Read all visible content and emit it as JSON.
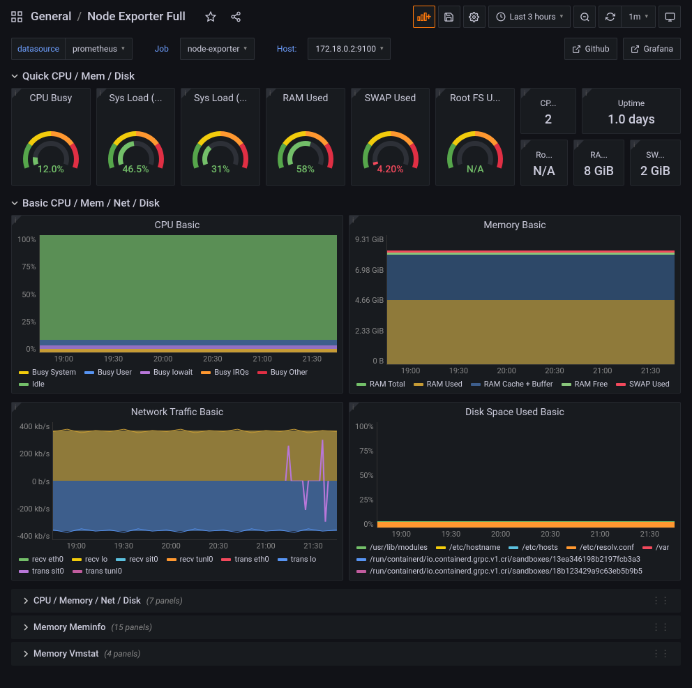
{
  "breadcrumb": {
    "parent": "General",
    "title": "Node Exporter Full"
  },
  "toolbar": {
    "time_range": "Last 3 hours",
    "refresh": "1m"
  },
  "vars": {
    "ds_label": "datasource",
    "ds_value": "prometheus",
    "job_label": "Job",
    "job_value": "node-exporter",
    "host_label": "Host:",
    "host_value": "172.18.0.2:9100"
  },
  "links": {
    "github": "Github",
    "grafana": "Grafana"
  },
  "sections": {
    "quick": "Quick CPU / Mem / Disk",
    "basic": "Basic CPU / Mem / Net / Disk",
    "r1": "CPU / Memory / Net / Disk",
    "r1c": "(7 panels)",
    "r2": "Memory Meminfo",
    "r2c": "(15 panels)",
    "r3": "Memory Vmstat",
    "r3c": "(4 panels)"
  },
  "gauges": [
    {
      "title": "CPU Busy",
      "value": "12.0%",
      "pct": 12,
      "color": "#73bf69"
    },
    {
      "title": "Sys Load (...",
      "value": "46.5%",
      "pct": 46.5,
      "color": "#73bf69"
    },
    {
      "title": "Sys Load (...",
      "value": "31%",
      "pct": 31,
      "color": "#73bf69"
    },
    {
      "title": "RAM Used",
      "value": "58%",
      "pct": 58,
      "color": "#73bf69"
    },
    {
      "title": "SWAP Used",
      "value": "4.20%",
      "pct": 4.2,
      "color": "#f2495c"
    },
    {
      "title": "Root FS U...",
      "value": "N/A",
      "pct": 0,
      "color": "#73bf69"
    }
  ],
  "stats": [
    {
      "title": "CP...",
      "value": "2"
    },
    {
      "title": "Uptime",
      "value": "1.0 days",
      "wide": true
    },
    {
      "title": "Ro...",
      "value": "N/A"
    },
    {
      "title": "RA...",
      "value": "8 GiB"
    },
    {
      "title": "SW...",
      "value": "2 GiB"
    }
  ],
  "x_ticks": [
    "19:00",
    "19:30",
    "20:00",
    "20:30",
    "21:00",
    "21:30"
  ],
  "chart_data": [
    {
      "type": "area",
      "title": "CPU Basic",
      "y_ticks": [
        "100%",
        "75%",
        "50%",
        "25%",
        "0%"
      ],
      "x_ticks": [
        "19:00",
        "19:30",
        "20:00",
        "20:30",
        "21:00",
        "21:30"
      ],
      "series": [
        {
          "name": "Busy System",
          "color": "#f2cc0c",
          "approx_pct": 3
        },
        {
          "name": "Busy User",
          "color": "#5794f2",
          "approx_pct": 5
        },
        {
          "name": "Busy Iowait",
          "color": "#b877d9",
          "approx_pct": 1
        },
        {
          "name": "Busy IRQs",
          "color": "#ff9830",
          "approx_pct": 1
        },
        {
          "name": "Busy Other",
          "color": "#e02f44",
          "approx_pct": 1
        },
        {
          "name": "Idle",
          "color": "#73bf69",
          "approx_pct": 89
        }
      ]
    },
    {
      "type": "area",
      "title": "Memory Basic",
      "y_ticks": [
        "9.31 GiB",
        "6.98 GiB",
        "4.66 GiB",
        "2.33 GiB",
        "0 B"
      ],
      "x_ticks": [
        "19:00",
        "19:30",
        "20:00",
        "20:30",
        "21:00",
        "21:30"
      ],
      "series": [
        {
          "name": "RAM Total",
          "color": "#73bf69",
          "approx_gib": 8.0
        },
        {
          "name": "RAM Used",
          "color": "#c69b35",
          "approx_gib": 4.6
        },
        {
          "name": "RAM Cache + Buffer",
          "color": "#3d5e8c",
          "approx_gib": 3.3
        },
        {
          "name": "RAM Free",
          "color": "#89c67b",
          "approx_gib": 0.1
        },
        {
          "name": "SWAP Used",
          "color": "#f2495c",
          "approx_gib": 0.08
        }
      ]
    },
    {
      "type": "area",
      "title": "Network Traffic Basic",
      "y_ticks": [
        "400 kb/s",
        "200 kb/s",
        "0 b/s",
        "-200 kb/s",
        "-400 kb/s"
      ],
      "x_ticks": [
        "19:00",
        "19:30",
        "20:00",
        "20:30",
        "21:00",
        "21:30"
      ],
      "series": [
        {
          "name": "recv eth0",
          "color": "#73bf69",
          "approx_kbps": 350
        },
        {
          "name": "recv lo",
          "color": "#f2cc0c",
          "approx_kbps": 340
        },
        {
          "name": "recv sit0",
          "color": "#5bc0de",
          "approx_kbps": 0
        },
        {
          "name": "recv tunl0",
          "color": "#ff9830",
          "approx_kbps": 0
        },
        {
          "name": "trans eth0",
          "color": "#f2495c",
          "approx_kbps": -350
        },
        {
          "name": "trans lo",
          "color": "#5794f2",
          "approx_kbps": -340
        },
        {
          "name": "trans sit0",
          "color": "#b877d9",
          "approx_kbps": 0
        },
        {
          "name": "trans tunl0",
          "color": "#c15c9e",
          "approx_kbps": 0
        }
      ]
    },
    {
      "type": "line",
      "title": "Disk Space Used Basic",
      "y_ticks": [
        "100%",
        "75%",
        "50%",
        "25%",
        "0%"
      ],
      "x_ticks": [
        "19:00",
        "19:30",
        "20:00",
        "20:30",
        "21:00",
        "21:30"
      ],
      "series": [
        {
          "name": "/usr/lib/modules",
          "color": "#73bf69",
          "approx_pct": 4
        },
        {
          "name": "/etc/hostname",
          "color": "#f2cc0c",
          "approx_pct": 4
        },
        {
          "name": "/etc/hosts",
          "color": "#5bc0de",
          "approx_pct": 4
        },
        {
          "name": "/etc/resolv.conf",
          "color": "#ff9830",
          "approx_pct": 4
        },
        {
          "name": "/var",
          "color": "#f2495c",
          "approx_pct": 4
        },
        {
          "name": "/run/containerd/io.containerd.grpc.v1.cri/sandboxes/13ea346198b2197fcb3a3",
          "color": "#5794f2",
          "approx_pct": 4
        },
        {
          "name": "/run/containerd/io.containerd.grpc.v1.cri/sandboxes/18b123429a9c63eb5b9b5",
          "color": "#c15c9e",
          "approx_pct": 4
        }
      ]
    }
  ]
}
